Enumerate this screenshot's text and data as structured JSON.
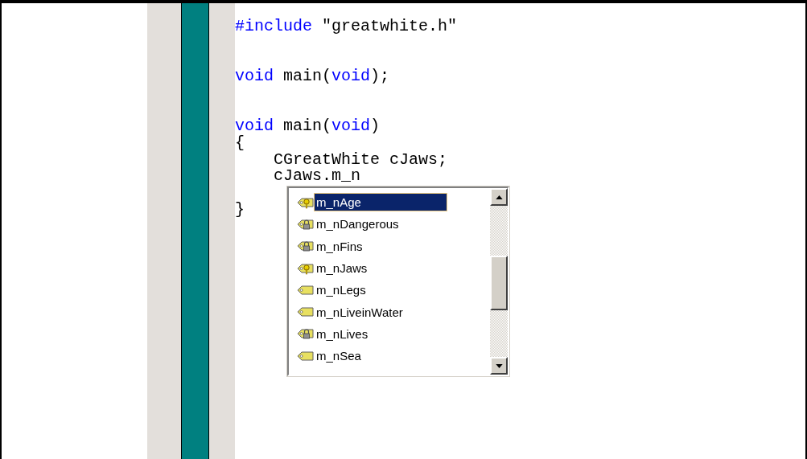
{
  "code_lines": [
    {
      "kind": "code",
      "segments": [
        {
          "kind": "keyword",
          "text": "#include"
        },
        {
          "kind": "plain",
          "text": " \"greatwhite.h\""
        }
      ]
    },
    {
      "kind": "blank"
    },
    {
      "kind": "blank"
    },
    {
      "kind": "code",
      "segments": [
        {
          "kind": "keyword",
          "text": "void"
        },
        {
          "kind": "plain",
          "text": " main("
        },
        {
          "kind": "keyword",
          "text": "void"
        },
        {
          "kind": "plain",
          "text": ");"
        }
      ]
    },
    {
      "kind": "blank"
    },
    {
      "kind": "blank"
    },
    {
      "kind": "code",
      "segments": [
        {
          "kind": "keyword",
          "text": "void"
        },
        {
          "kind": "plain",
          "text": " main("
        },
        {
          "kind": "keyword",
          "text": "void"
        },
        {
          "kind": "plain",
          "text": ")"
        }
      ]
    },
    {
      "kind": "code",
      "segments": [
        {
          "kind": "plain",
          "text": "{"
        }
      ]
    },
    {
      "kind": "code",
      "segments": [
        {
          "kind": "plain",
          "text": "    CGreatWhite cJaws;"
        }
      ]
    },
    {
      "kind": "code",
      "segments": [
        {
          "kind": "plain",
          "text": "    cJaws.m_n"
        }
      ]
    },
    {
      "kind": "blank"
    },
    {
      "kind": "code",
      "segments": [
        {
          "kind": "plain",
          "text": "}"
        }
      ]
    }
  ],
  "completion_list": {
    "items": [
      {
        "label": "m_nAge",
        "kind": "protected",
        "selected": true
      },
      {
        "label": "m_nDangerous",
        "kind": "private",
        "selected": false
      },
      {
        "label": "m_nFins",
        "kind": "private",
        "selected": false
      },
      {
        "label": "m_nJaws",
        "kind": "protected",
        "selected": false
      },
      {
        "label": "m_nLegs",
        "kind": "public",
        "selected": false
      },
      {
        "label": "m_nLiveinWater",
        "kind": "public",
        "selected": false
      },
      {
        "label": "m_nLives",
        "kind": "private",
        "selected": false
      },
      {
        "label": "m_nSea",
        "kind": "public",
        "selected": false
      }
    ]
  }
}
